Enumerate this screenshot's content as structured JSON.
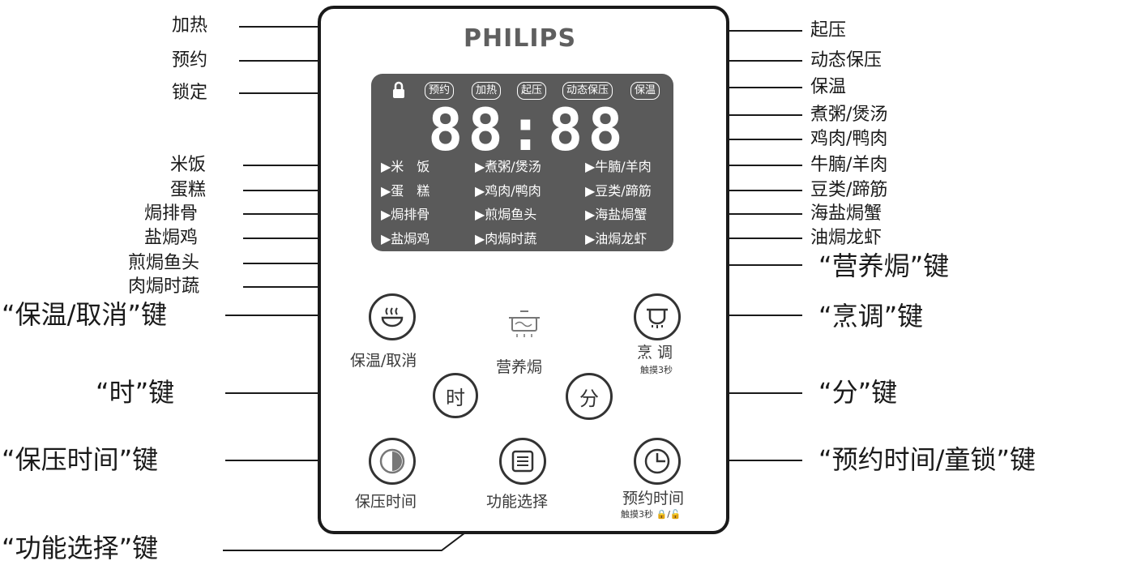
{
  "brand": "PHILIPS",
  "display": {
    "icons": [
      "预约",
      "加热",
      "起压",
      "动态保压",
      "保温"
    ],
    "digits": "88:88",
    "menu": {
      "col1": [
        "▶米　饭",
        "▶蛋　糕",
        "▶焗排骨",
        "▶盐焗鸡"
      ],
      "col2": [
        "▶煮粥/煲汤",
        "▶鸡肉/鸭肉",
        "▶煎焗鱼头",
        "▶肉焗时蔬"
      ],
      "col3": [
        "▶牛腩/羊肉",
        "▶豆类/蹄筋",
        "▶海盐焗蟹",
        "▶油焗龙虾"
      ]
    }
  },
  "callouts": {
    "left_top": [
      "加热",
      "预约",
      "锁定"
    ],
    "left_menu": [
      "米饭",
      "蛋糕",
      "焗排骨",
      "盐焗鸡",
      "煎焗鱼头",
      "肉焗时蔬"
    ],
    "right_top": [
      "起压",
      "动态保压",
      "保温",
      "煮粥/煲汤",
      "鸡肉/鸭肉",
      "牛腩/羊肉",
      "豆类/蹄筋",
      "海盐焗蟹",
      "油焗龙虾"
    ],
    "keys": {
      "keep_warm": "“保温/取消”键",
      "hour": "“时”键",
      "pressure_time": "“保压时间”键",
      "function_select": "“功能选择”键",
      "nutrition_bake": "“营养焗”键",
      "cook": "“烹调”键",
      "minute": "“分”键",
      "preset_lock": "“预约时间/童锁”键"
    }
  },
  "buttons": {
    "keep_warm_label": "保温/取消",
    "nutrition_label": "营养焗",
    "cook_label": "烹 调",
    "cook_hint": "触摸3秒",
    "hour_glyph": "时",
    "minute_glyph": "分",
    "pressure_time_label": "保压时间",
    "function_label": "功能选择",
    "preset_label": "预约时间",
    "preset_hint": "触摸3秒 🔒/🔓"
  }
}
